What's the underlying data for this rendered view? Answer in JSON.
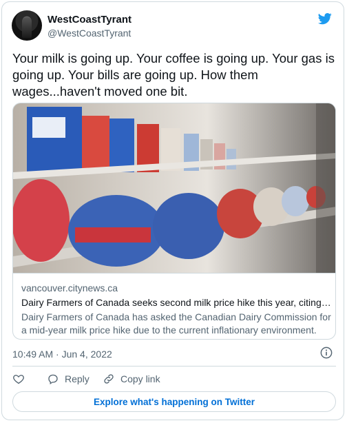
{
  "author": {
    "display_name": "WestCoastTyrant",
    "handle": "@WestCoastTyrant",
    "avatar_icon": "avatar-photo"
  },
  "tweet": {
    "text": "Your milk is going up. Your coffee is going up. Your gas is going up. Your bills are going up. How them wages...haven't moved one bit.",
    "timestamp": "10:49 AM · Jun 4, 2022"
  },
  "link_card": {
    "domain": "vancouver.citynews.ca",
    "headline": "Dairy Farmers of Canada seeks second milk price hike this year, citing i…",
    "description": "Dairy Farmers of Canada has asked the Canadian Dairy Commission for a mid-year milk price hike due to the current inflationary environment.",
    "image_subject": "milk cartons and bags on a grocery store dairy shelf"
  },
  "actions": {
    "like_icon": "heart-icon",
    "reply_label": "Reply",
    "copy_label": "Copy link"
  },
  "footer": {
    "explore_label": "Explore what's happening on Twitter"
  },
  "colors": {
    "brand_blue": "#1d9bf0",
    "link_blue": "#006fd6",
    "secondary_text": "#536471",
    "border": "#cfd9de"
  }
}
